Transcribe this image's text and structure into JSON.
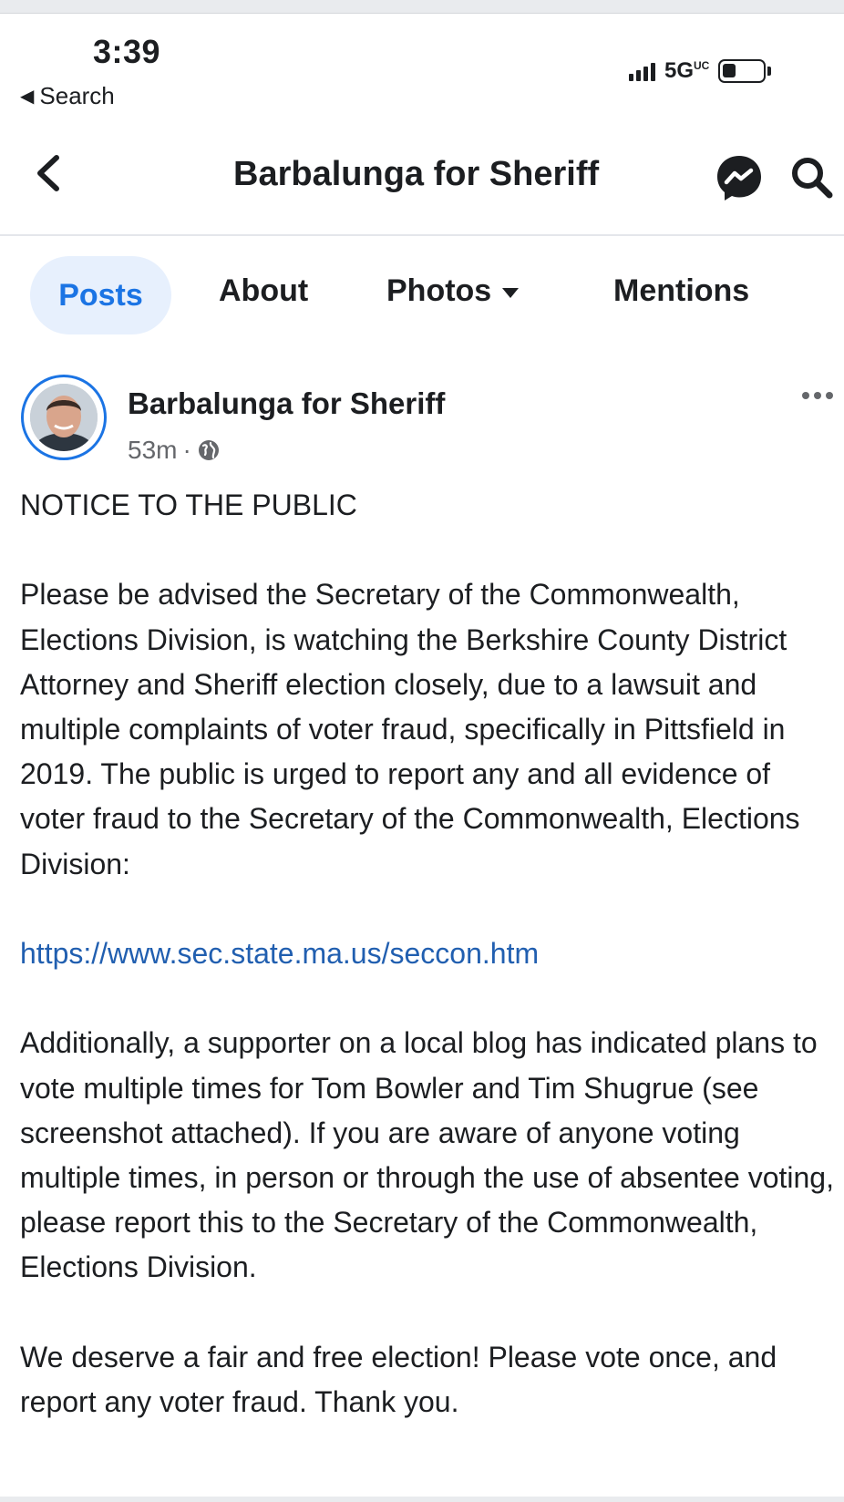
{
  "status_bar": {
    "time": "3:39",
    "back_app_label": "Search",
    "network": "5G",
    "network_suffix": "UC"
  },
  "nav": {
    "title": "Barbalunga for Sheriff",
    "back_icon": "chevron-left-icon",
    "messenger_icon": "messenger-icon",
    "search_icon": "search-icon"
  },
  "tabs": [
    {
      "label": "Posts",
      "selected": true
    },
    {
      "label": "About",
      "selected": false
    },
    {
      "label": "Photos",
      "selected": false
    },
    {
      "label": "Mentions",
      "selected": false
    }
  ],
  "post": {
    "author": "Barbalunga for Sheriff",
    "time_ago": "53m",
    "separator": "·",
    "audience_icon": "globe-icon",
    "heading": "NOTICE TO THE PUBLIC",
    "paragraph1": "Please be advised the Secretary of the Commonwealth, Elections Division, is watching the Berkshire County District Attorney and Sheriff election closely, due to a lawsuit and multiple complaints of voter fraud, specifically in Pittsfield in 2019. The public is urged to report any and all evidence of voter fraud to the Secretary of the Commonwealth, Elections Division:",
    "link": "https://www.sec.state.ma.us/seccon.htm",
    "paragraph2": "Additionally, a supporter on a local blog has indicated plans to vote multiple times for Tom Bowler and Tim Shugrue (see screenshot attached).  If you are aware of anyone voting multiple times, in person or through the use of absentee voting, please report this to the Secretary of the Commonwealth, Elections Division.",
    "paragraph3": "We deserve a fair and free election!  Please vote once, and report any voter fraud.  Thank you."
  },
  "colors": {
    "accent": "#1b74e4",
    "link": "#215fb0",
    "tab_selected_bg": "#e7f0fd",
    "secondary_text": "#65676b"
  }
}
